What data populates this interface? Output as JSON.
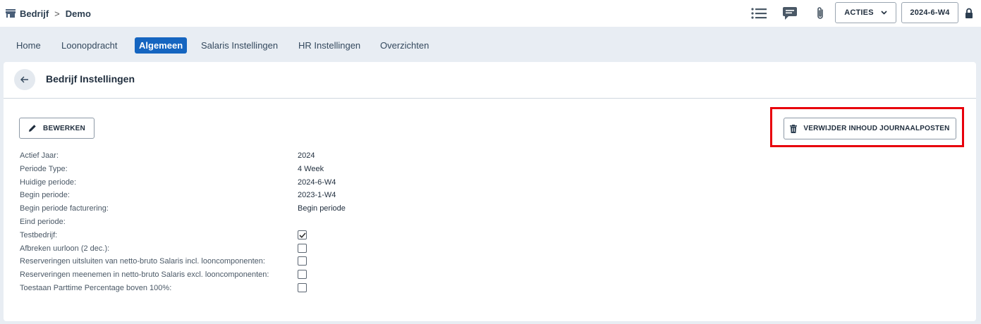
{
  "breadcrumb": {
    "root": "Bedrijf",
    "separator": ">",
    "current": "Demo"
  },
  "toolbar": {
    "acties_label": "ACTIES",
    "period_label": "2024-6-W4"
  },
  "tabs": [
    {
      "label": "Home",
      "active": false
    },
    {
      "label": "Loonopdracht",
      "active": false
    },
    {
      "label": "Algemeen",
      "active": true
    },
    {
      "label": "Salaris Instellingen",
      "active": false
    },
    {
      "label": "HR Instellingen",
      "active": false
    },
    {
      "label": "Overzichten",
      "active": false
    }
  ],
  "page": {
    "title": "Bedrijf Instellingen",
    "edit_label": "BEWERKEN",
    "delete_label": "VERWIJDER INHOUD JOURNAALPOSTEN"
  },
  "fields": [
    {
      "label": "Actief Jaar:",
      "value": "2024"
    },
    {
      "label": "Periode Type:",
      "value": "4 Week"
    },
    {
      "label": "Huidige periode:",
      "value": "2024-6-W4"
    },
    {
      "label": "Begin periode:",
      "value": "2023-1-W4"
    },
    {
      "label": "Begin periode facturering:",
      "value": "Begin periode"
    },
    {
      "label": "Eind periode:",
      "value": ""
    }
  ],
  "checks": [
    {
      "label": "Testbedrijf:",
      "checked": true
    },
    {
      "label": "Afbreken uurloon (2 dec.):",
      "checked": false
    },
    {
      "label": "Reserveringen uitsluiten van netto-bruto Salaris incl. looncomponenten:",
      "checked": false
    },
    {
      "label": "Reserveringen meenemen in netto-bruto Salaris excl. looncomponenten:",
      "checked": false
    },
    {
      "label": "Toestaan Parttime Percentage boven 100%:",
      "checked": false
    }
  ],
  "colors": {
    "accent": "#1565c0",
    "highlight": "#e8000b",
    "background": "#e8edf3"
  }
}
